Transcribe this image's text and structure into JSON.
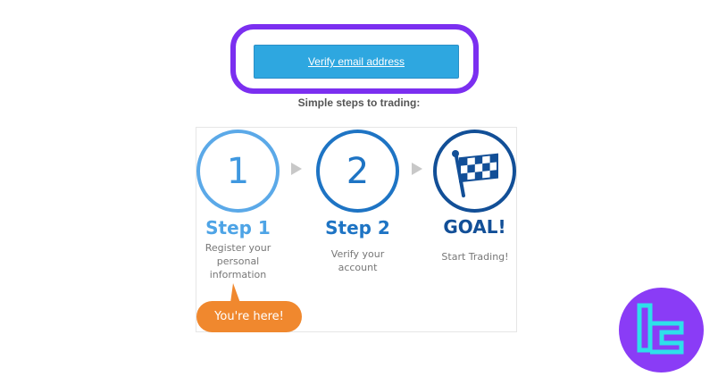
{
  "verify_button": {
    "label": "Verify email address"
  },
  "steps_title": "Simple steps to trading:",
  "steps": [
    {
      "number": "1",
      "title": "Step 1",
      "description": "Register your personal information"
    },
    {
      "number": "2",
      "title": "Step 2",
      "description": "Verify your account"
    },
    {
      "title": "GOAL!",
      "description": "Start Trading!"
    }
  ],
  "current_step_badge": "You're here!",
  "colors": {
    "highlight": "#7b2ff0",
    "button": "#2ea7e0",
    "step1": "#5ba9e8",
    "step2": "#1e74c4",
    "goal": "#124f97",
    "badge": "#f0882e",
    "logo_bg": "#8a3cf6",
    "logo_fg": "#2de0ea"
  }
}
